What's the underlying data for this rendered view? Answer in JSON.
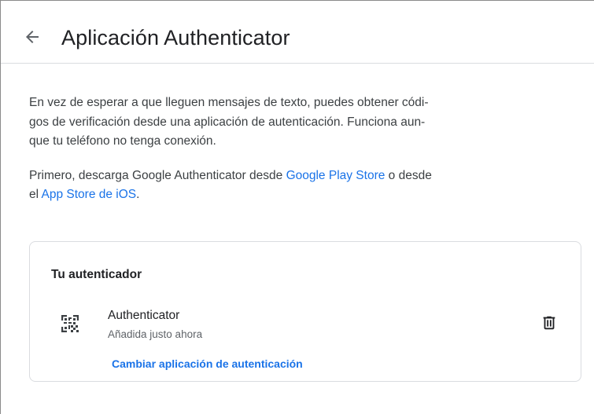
{
  "header": {
    "back_icon": "arrow-back-icon",
    "title": "Aplicación Authenticator"
  },
  "intro": {
    "paragraph1_line1": "En vez de esperar a que lleguen mensajes de texto, puedes obtener códi-",
    "paragraph1_line2": "gos de verificación desde una aplicación de autenticación. Funciona aun-",
    "paragraph1_line3": "que tu teléfono no tenga conexión.",
    "paragraph2_prefix": "Primero, descarga Google Authenticator desde ",
    "play_store_link": "Google Play Store",
    "paragraph2_middle": " o desde",
    "paragraph2_line2_prefix": "el ",
    "app_store_link": "App Store de iOS",
    "paragraph2_suffix": "."
  },
  "authenticator_card": {
    "title": "Tu autenticador",
    "app_icon": "qr-code-icon",
    "app_name": "Authenticator",
    "added_status": "Añadida justo ahora",
    "change_link": "Cambiar aplicación de autenticación",
    "delete_icon": "trash-icon"
  },
  "colors": {
    "link": "#1a73e8",
    "text_primary": "#202124",
    "text_secondary": "#5f6368",
    "border": "#dadce0"
  }
}
